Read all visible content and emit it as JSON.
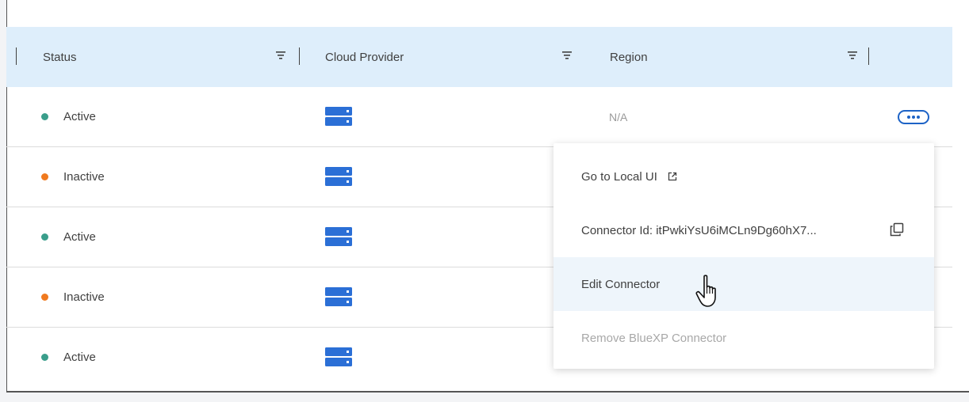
{
  "table": {
    "columns": [
      {
        "label": "Status"
      },
      {
        "label": "Cloud Provider"
      },
      {
        "label": "Region"
      }
    ],
    "rows": [
      {
        "status": "Active",
        "status_color": "#3a9e8b",
        "provider_icon": "server-icon",
        "region": "N/A"
      },
      {
        "status": "Inactive",
        "status_color": "#f07a1f",
        "provider_icon": "server-icon",
        "region": ""
      },
      {
        "status": "Active",
        "status_color": "#3a9e8b",
        "provider_icon": "server-icon",
        "region": ""
      },
      {
        "status": "Inactive",
        "status_color": "#f07a1f",
        "provider_icon": "server-icon",
        "region": ""
      },
      {
        "status": "Active",
        "status_color": "#3a9e8b",
        "provider_icon": "server-icon",
        "region": ""
      }
    ]
  },
  "menu": {
    "items": [
      {
        "label": "Go to Local UI",
        "icon": "external-link-icon"
      },
      {
        "label": "Connector Id: itPwkiYsU6iMCLn9Dg60hX7...",
        "icon": "copy-icon"
      },
      {
        "label": "Edit Connector",
        "state": "hovered"
      },
      {
        "label": "Remove BlueXP Connector",
        "state": "disabled"
      }
    ]
  },
  "colors": {
    "header_bg": "#deeefb",
    "accent": "#1d63c6",
    "provider_blue": "#2b6fd6",
    "active": "#3a9e8b",
    "inactive": "#f07a1f"
  }
}
